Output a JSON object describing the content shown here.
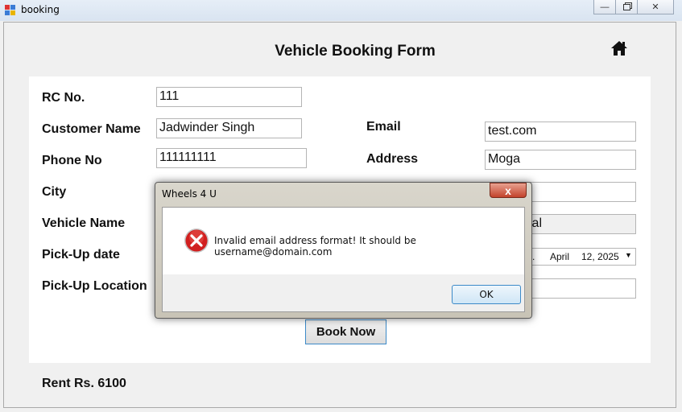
{
  "window": {
    "title": "booking",
    "controls": [
      "minimize-icon",
      "restore-icon",
      "close-icon"
    ]
  },
  "form": {
    "title": "Vehicle Booking Form",
    "home_icon": "home-icon",
    "fields": {
      "rc_no": {
        "label": "RC No.",
        "value": "111"
      },
      "customer_name": {
        "label": "Customer Name",
        "value": "Jadwinder Singh"
      },
      "phone_no": {
        "label": "Phone No",
        "value": "111111111"
      },
      "city": {
        "label": "City",
        "value": ""
      },
      "vehicle_name": {
        "label": "Vehicle Name",
        "value": ""
      },
      "pickup_date": {
        "label": "Pick-Up date",
        "value": ""
      },
      "pickup_location": {
        "label": "Pick-Up Location",
        "value": ""
      },
      "email": {
        "label": "Email",
        "value": "test.com"
      },
      "address": {
        "label": "Address",
        "value": "Moga"
      },
      "right_city_value": "",
      "right_vehicle_type_value": "ical",
      "right_date": {
        "month": "April",
        "day_year": "12, 2025"
      },
      "right_location_value": ""
    },
    "book_button": "Book Now",
    "rent": "Rent Rs. 6100"
  },
  "dialog": {
    "title": "Wheels 4 U",
    "close_glyph": "x",
    "icon": "error-icon",
    "message": "Invalid email address format! It should be username@domain.com",
    "ok_label": "OK"
  },
  "colors": {
    "accent_border": "#3c8ac8",
    "error_red": "#d11f1f",
    "dialog_close": "#c3432c"
  }
}
